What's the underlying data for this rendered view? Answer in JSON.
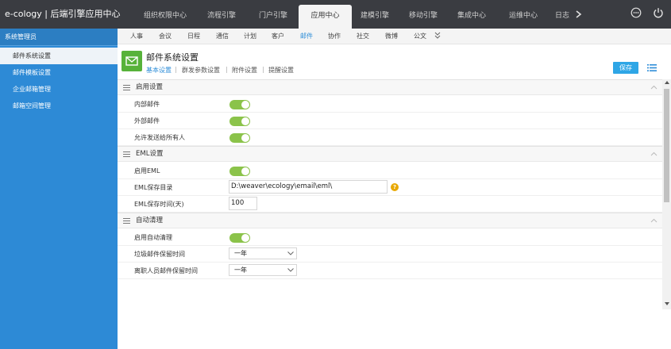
{
  "app": {
    "brand": "e-cology | 后端引擎应用中心"
  },
  "top_nav": {
    "tabs": [
      {
        "label": "组织权限中心",
        "active": false
      },
      {
        "label": "流程引擎",
        "active": false
      },
      {
        "label": "门户引擎",
        "active": false
      },
      {
        "label": "应用中心",
        "active": true
      },
      {
        "label": "建模引擎",
        "active": false
      },
      {
        "label": "移动引擎",
        "active": false
      },
      {
        "label": "集成中心",
        "active": false
      },
      {
        "label": "运维中心",
        "active": false
      },
      {
        "label": "日志",
        "active": false
      }
    ],
    "more_icon": "chevron-right-icon",
    "right_icons": [
      "more-circle-icon",
      "power-icon"
    ]
  },
  "sub_nav": {
    "tabs": [
      {
        "label": "人事",
        "active": false
      },
      {
        "label": "会议",
        "active": false
      },
      {
        "label": "日程",
        "active": false
      },
      {
        "label": "通信",
        "active": false
      },
      {
        "label": "计划",
        "active": false
      },
      {
        "label": "客户",
        "active": false
      },
      {
        "label": "邮件",
        "active": true
      },
      {
        "label": "协作",
        "active": false
      },
      {
        "label": "社交",
        "active": false
      },
      {
        "label": "微博",
        "active": false
      },
      {
        "label": "公文",
        "active": false
      }
    ],
    "more_icon": "double-chevron-down-icon"
  },
  "sidebar": {
    "header": "系统管理员",
    "items": [
      {
        "label": "邮件系统设置",
        "active": true
      },
      {
        "label": "邮件模板设置",
        "active": false
      },
      {
        "label": "企业邮箱管理",
        "active": false
      },
      {
        "label": "邮箱空间管理",
        "active": false
      }
    ]
  },
  "page": {
    "icon": "mail-icon",
    "title": "邮件系统设置",
    "tabs": [
      {
        "label": "基本设置",
        "active": true
      },
      {
        "label": "群发参数设置",
        "active": false
      },
      {
        "label": "附件设置",
        "active": false
      },
      {
        "label": "提醒设置",
        "active": false
      }
    ],
    "separator": "|",
    "save_label": "保存",
    "menu_icon": "list-menu-icon"
  },
  "sections": {
    "enable": {
      "title": "启用设置",
      "rows": {
        "internal": {
          "label": "内部邮件",
          "on": true
        },
        "external": {
          "label": "外部邮件",
          "on": true
        },
        "allow_all": {
          "label": "允许发送给所有人",
          "on": true
        }
      }
    },
    "eml": {
      "title": "EML设置",
      "rows": {
        "enable_eml": {
          "label": "启用EML",
          "on": true
        },
        "save_dir": {
          "label": "EML保存目录",
          "value": "D:\\weaver\\ecology\\email\\eml\\"
        },
        "save_days": {
          "label": "EML保存时间(天)",
          "value": "100"
        }
      }
    },
    "auto_clean": {
      "title": "自动清理",
      "rows": {
        "enable_clean": {
          "label": "启用自动清理",
          "on": true
        },
        "trash_keep": {
          "label": "垃圾邮件保留时间",
          "value": "一年"
        },
        "resigned_keep": {
          "label": "离职人员邮件保留时间",
          "value": "一年"
        }
      }
    }
  },
  "colors": {
    "topbar": "#3a3c41",
    "sidebar": "#2d8ad6",
    "accent": "#2f8ed8",
    "toggle_on": "#8bc34a",
    "save_button": "#2ea6e6"
  }
}
